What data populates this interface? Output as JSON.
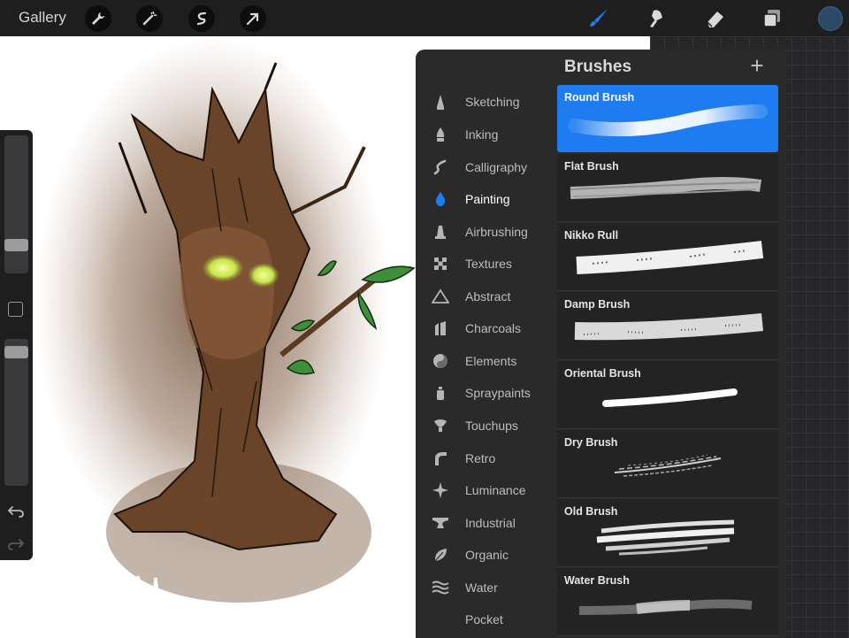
{
  "toolbar": {
    "gallery_label": "Gallery",
    "left_tools": [
      "wrench-icon",
      "magic-wand-icon",
      "selection-icon",
      "transform-arrow-icon"
    ],
    "right_tools": [
      "brush-icon",
      "smudge-icon",
      "eraser-icon",
      "layers-icon"
    ],
    "active_tool": "brush-icon",
    "current_color": "#2c4a68",
    "accent_color": "#1e7cf0"
  },
  "panel": {
    "title": "Brushes",
    "add_label": "+",
    "categories": [
      {
        "label": "Sketching",
        "icon": "pencil-tip-icon"
      },
      {
        "label": "Inking",
        "icon": "pen-nib-icon"
      },
      {
        "label": "Calligraphy",
        "icon": "calligraphy-icon"
      },
      {
        "label": "Painting",
        "icon": "paint-drop-icon"
      },
      {
        "label": "Airbrushing",
        "icon": "airbrush-icon"
      },
      {
        "label": "Textures",
        "icon": "texture-icon"
      },
      {
        "label": "Abstract",
        "icon": "triangle-icon"
      },
      {
        "label": "Charcoals",
        "icon": "charcoal-icon"
      },
      {
        "label": "Elements",
        "icon": "yin-yang-icon"
      },
      {
        "label": "Spraypaints",
        "icon": "spray-can-icon"
      },
      {
        "label": "Touchups",
        "icon": "touchup-icon"
      },
      {
        "label": "Retro",
        "icon": "retro-icon"
      },
      {
        "label": "Luminance",
        "icon": "sparkle-icon"
      },
      {
        "label": "Industrial",
        "icon": "anvil-icon"
      },
      {
        "label": "Organic",
        "icon": "leaf-icon"
      },
      {
        "label": "Water",
        "icon": "waves-icon"
      },
      {
        "label": "Pocket",
        "icon": ""
      }
    ],
    "active_category": "Painting",
    "brushes": [
      {
        "name": "Round Brush"
      },
      {
        "name": "Flat Brush"
      },
      {
        "name": "Nikko Rull"
      },
      {
        "name": "Damp Brush"
      },
      {
        "name": "Oriental Brush"
      },
      {
        "name": "Dry Brush"
      },
      {
        "name": "Old Brush"
      },
      {
        "name": "Water Brush"
      }
    ],
    "active_brush": "Round Brush"
  },
  "sidebar": {
    "size_level": 0.25,
    "opacity_level": 0.97,
    "undo_icon": "undo-icon",
    "redo_icon": "redo-icon"
  }
}
